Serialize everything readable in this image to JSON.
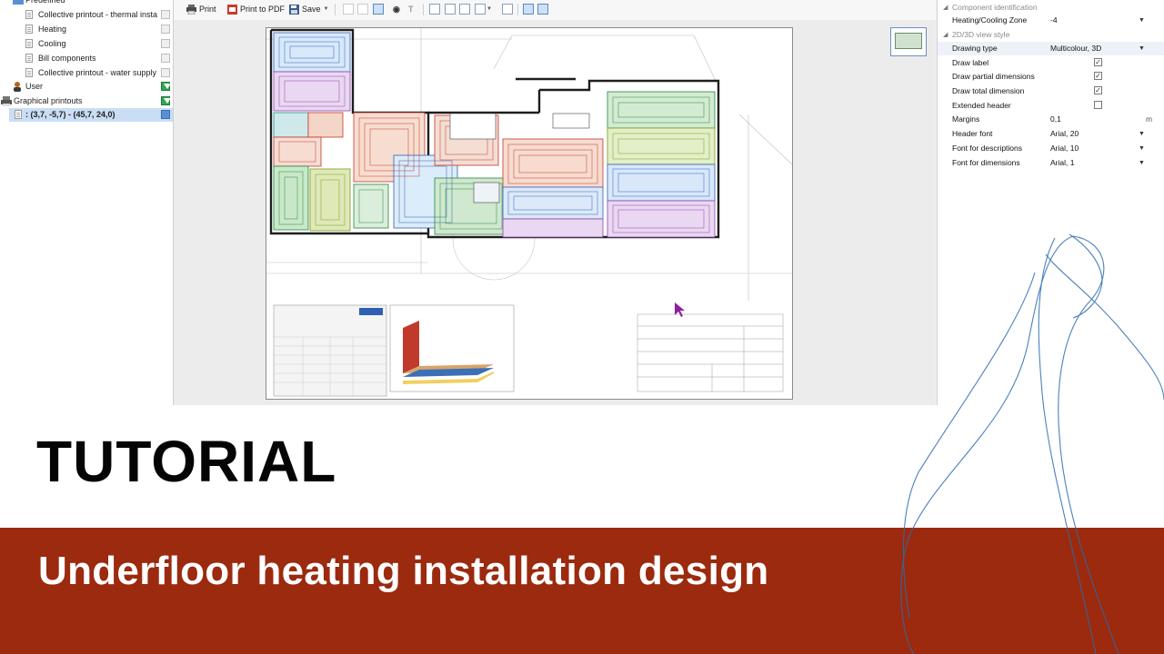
{
  "tree": {
    "items": [
      {
        "label": "Predefined",
        "type": "folder"
      },
      {
        "label": "Collective printout - thermal insta",
        "type": "doc"
      },
      {
        "label": "Heating",
        "type": "doc"
      },
      {
        "label": "Cooling",
        "type": "doc"
      },
      {
        "label": "Bill components",
        "type": "doc"
      },
      {
        "label": "Collective printout - water supply",
        "type": "doc"
      },
      {
        "label": "User",
        "type": "folder"
      },
      {
        "label": "Graphical printouts",
        "type": "folder"
      },
      {
        "label": ": (3,7, -5,7) - (45,7, 24,0)",
        "type": "doc",
        "selected": true
      }
    ]
  },
  "toolbar": {
    "print_label": "Print",
    "print_pdf_label": "Print to PDF",
    "save_label": "Save"
  },
  "properties": {
    "section_component": "Component identification",
    "zone_key": "Heating/Cooling Zone",
    "zone_value": "-4",
    "section_view": "2D/3D view style",
    "rows": [
      {
        "key": "Drawing type",
        "value": "Multicolour, 3D",
        "kind": "select"
      },
      {
        "key": "Draw label",
        "value": "",
        "kind": "check",
        "checked": true
      },
      {
        "key": "Draw partial dimensions",
        "value": "",
        "kind": "check",
        "checked": true
      },
      {
        "key": "Draw total dimension",
        "value": "",
        "kind": "check",
        "checked": true
      },
      {
        "key": "Extended header",
        "value": "",
        "kind": "check",
        "checked": false
      },
      {
        "key": "Margins",
        "value": "0,1",
        "kind": "unit",
        "unit": "m"
      },
      {
        "key": "Header font",
        "value": "Arial, 20",
        "kind": "select"
      },
      {
        "key": "Font for descriptions",
        "value": "Arial, 10",
        "kind": "select"
      },
      {
        "key": "Font for dimensions",
        "value": "Arial, 1",
        "kind": "select"
      }
    ]
  },
  "banner": {
    "heading": "TUTORIAL",
    "subtitle": "Underfloor heating installation design"
  },
  "colors": {
    "band": "#9b2a0e",
    "heading_text": "#050505",
    "subtitle_text": "#ffffff",
    "deco_line": "#2b6cb0"
  }
}
